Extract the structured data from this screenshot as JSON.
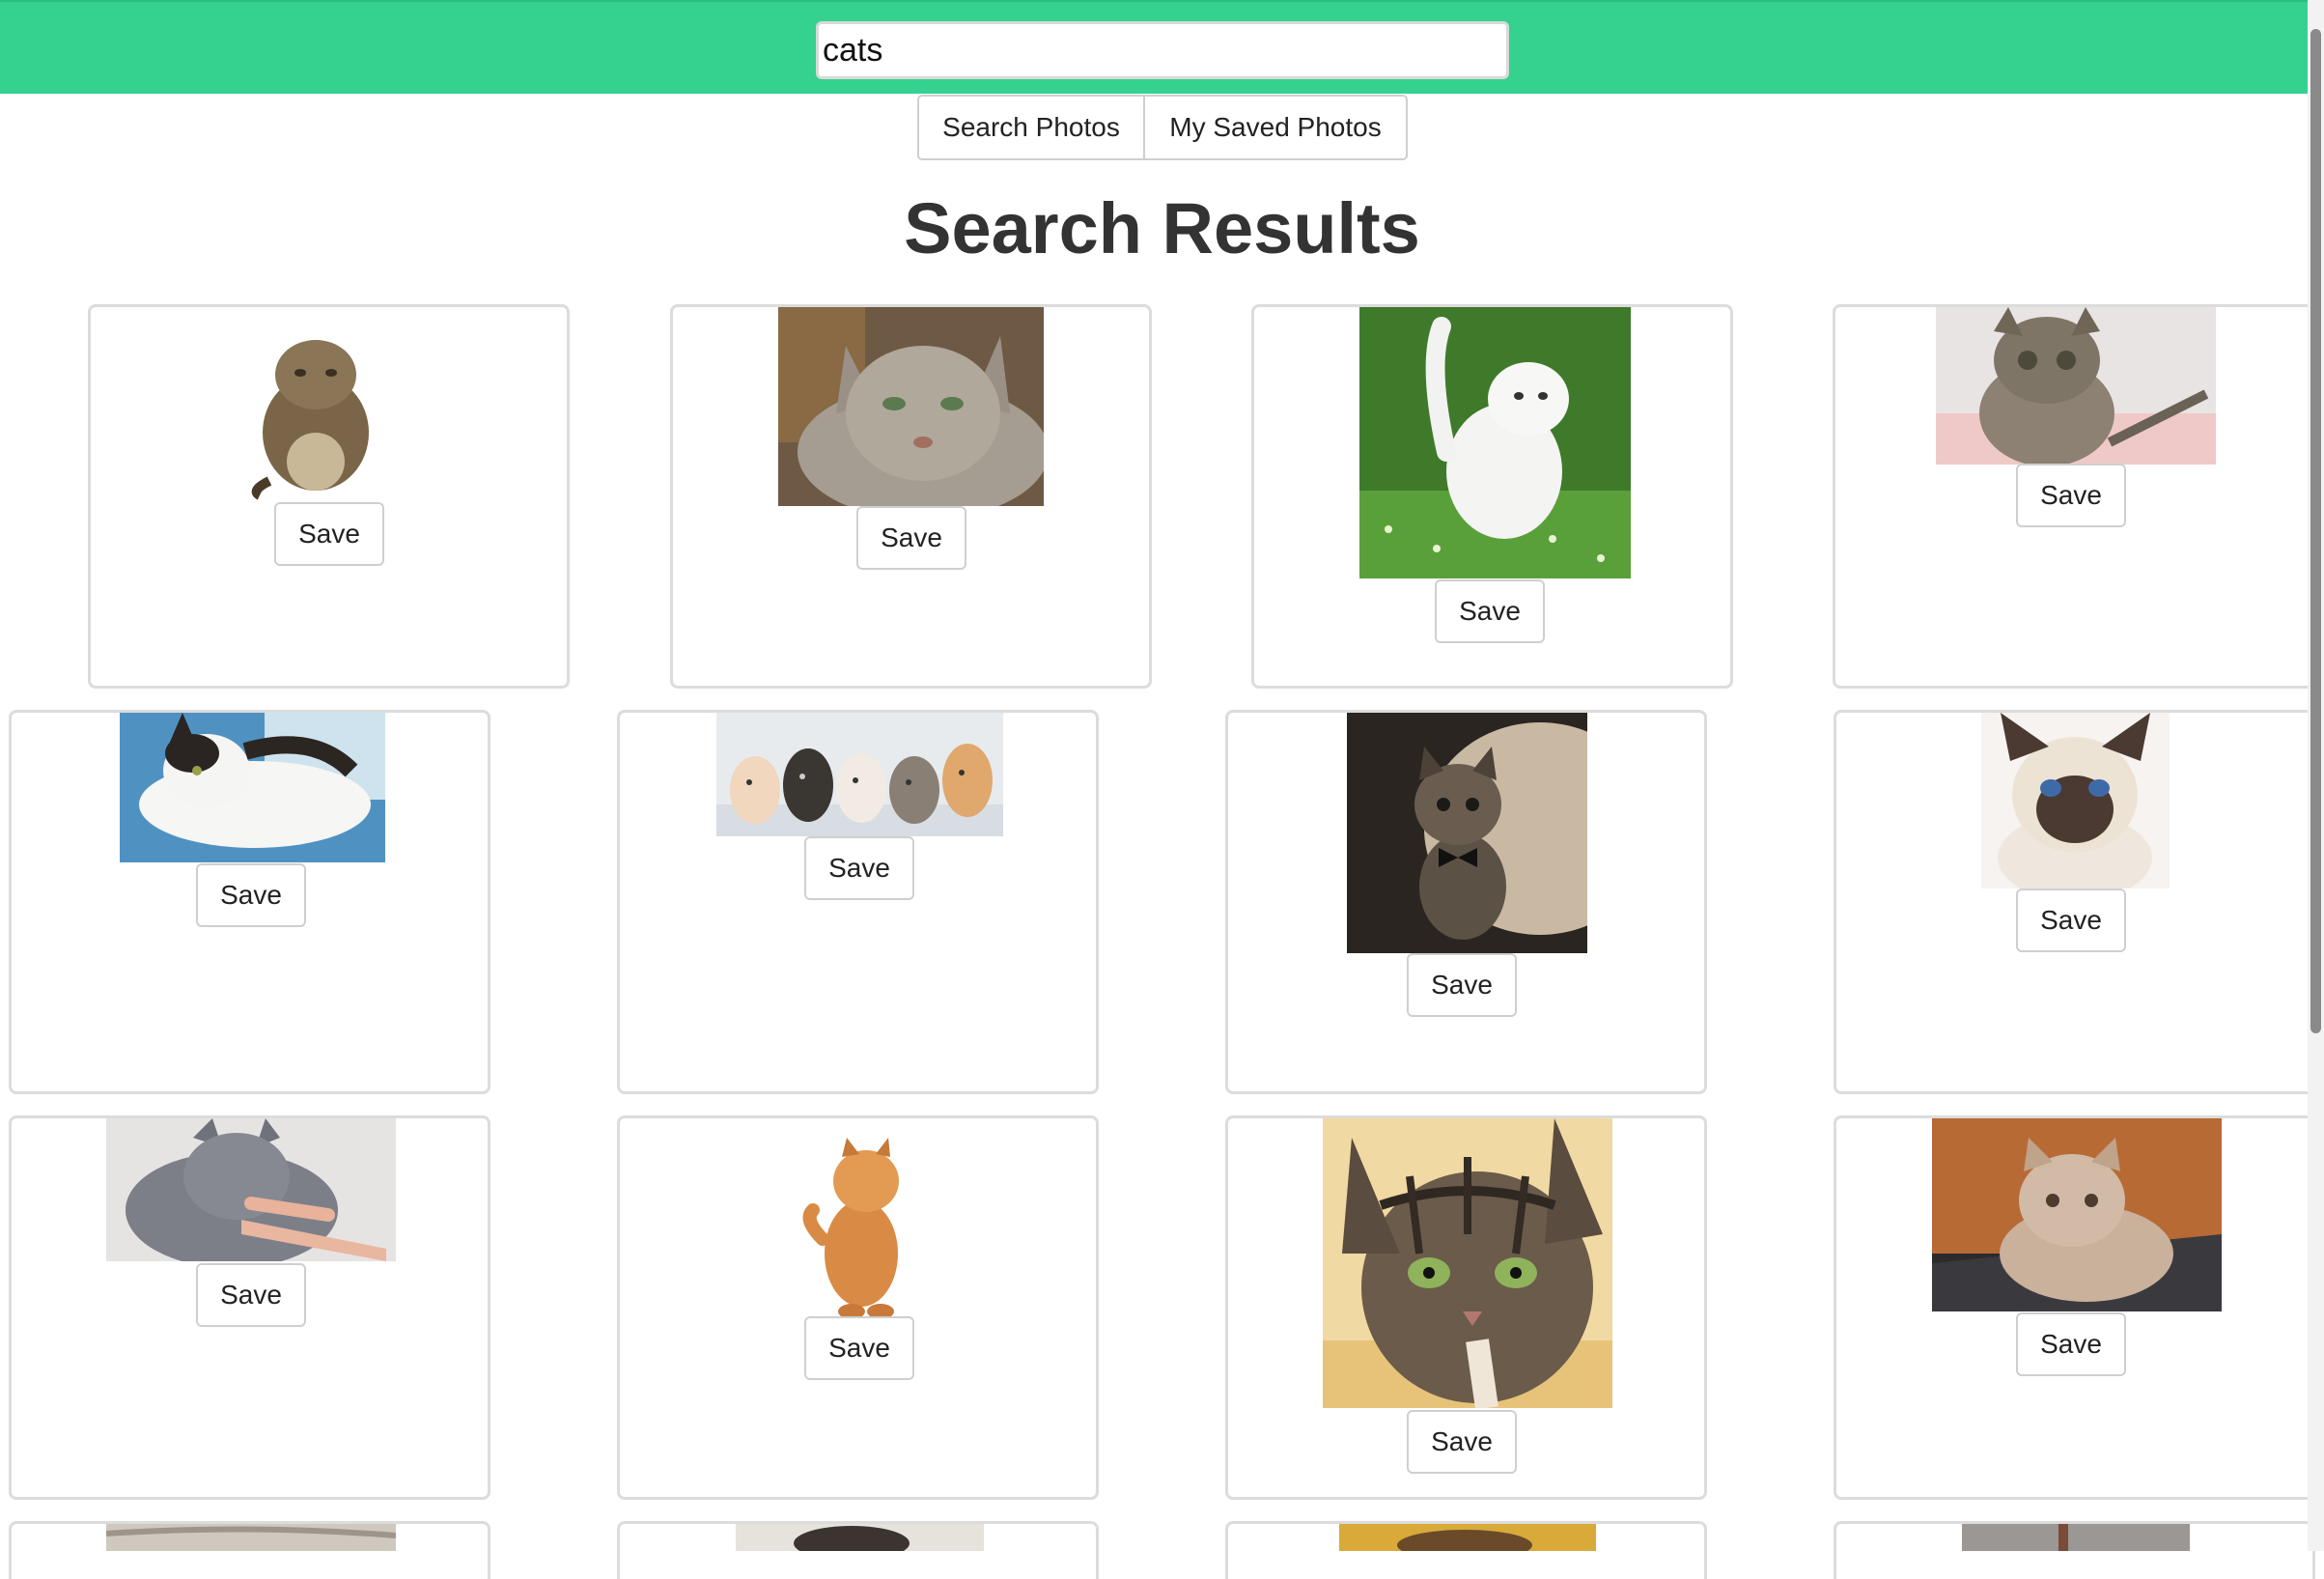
{
  "search": {
    "value": "cats",
    "placeholder": ""
  },
  "nav": {
    "search_label": "Search Photos",
    "saved_label": "My Saved Photos"
  },
  "heading": "Search Results",
  "save_label": "Save",
  "photos": [
    {
      "subject": "cat"
    },
    {
      "subject": "cat"
    },
    {
      "subject": "cat"
    },
    {
      "subject": "cat"
    },
    {
      "subject": "cat"
    },
    {
      "subject": "cat"
    },
    {
      "subject": "cat"
    },
    {
      "subject": "cat"
    },
    {
      "subject": "cat"
    },
    {
      "subject": "cat"
    },
    {
      "subject": "cat"
    },
    {
      "subject": "cat"
    },
    {
      "subject": "cat"
    },
    {
      "subject": "cat"
    },
    {
      "subject": "cat"
    },
    {
      "subject": "cat"
    }
  ],
  "colors": {
    "header": "#34d18f",
    "card_border": "#dcdcdc"
  }
}
